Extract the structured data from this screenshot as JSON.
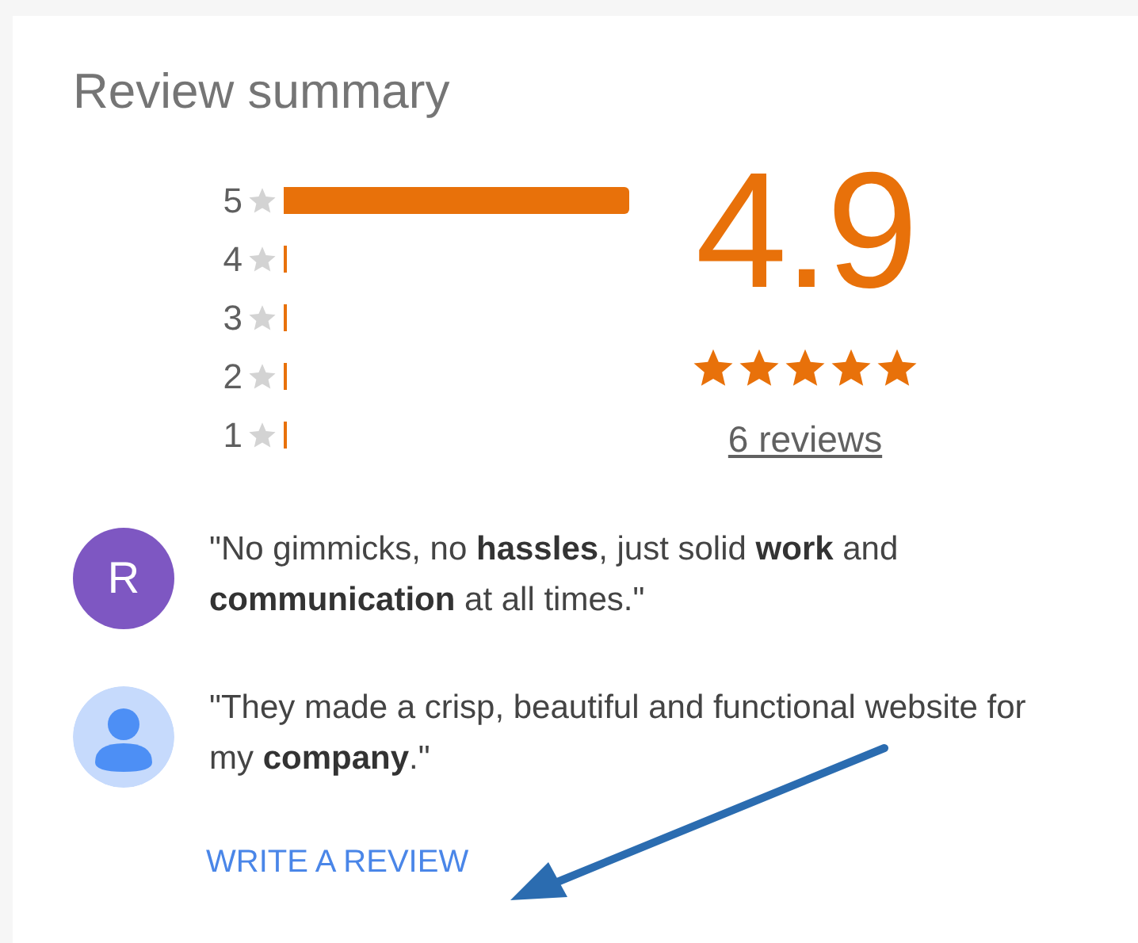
{
  "title": "Review summary",
  "histogram": [
    {
      "label": "5",
      "level": 1
    },
    {
      "label": "4",
      "level": 0
    },
    {
      "label": "3",
      "level": 0
    },
    {
      "label": "2",
      "level": 0
    },
    {
      "label": "1",
      "level": 0
    }
  ],
  "rating": {
    "value": "4.9",
    "stars": 5,
    "count": "6 reviews"
  },
  "reviews": [
    {
      "avatar": {
        "kind": "letter",
        "letter": "R",
        "color": "#7e57c2"
      },
      "text": "\"No gimmicks, no **hassles**, just solid **work** and **communication** at all times.\""
    },
    {
      "avatar": {
        "kind": "silhouette",
        "color": "#c6dafc"
      },
      "text": "\"They made a crisp, beautiful and functional website for my **company**.\""
    }
  ],
  "action": "WRITE A REVIEW"
}
